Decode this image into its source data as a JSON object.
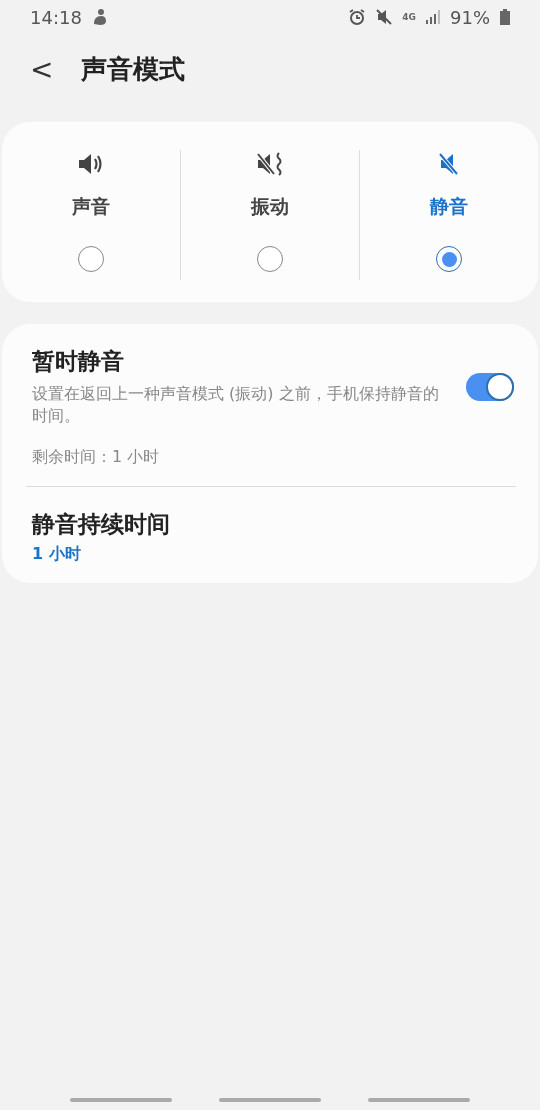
{
  "status_bar": {
    "time": "14:18",
    "network": "4G",
    "battery": "91%"
  },
  "header": {
    "back": "<",
    "title": "声音模式"
  },
  "modes": [
    {
      "kind": "sound",
      "label": "声音",
      "selected": false
    },
    {
      "kind": "vibrate",
      "label": "振动",
      "selected": false
    },
    {
      "kind": "mute",
      "label": "静音",
      "selected": true
    }
  ],
  "temporary_mute": {
    "title": "暂时静音",
    "description": "设置在返回上一种声音模式 (振动) 之前，手机保持静音的时间。",
    "on": true,
    "remaining": "剩余时间：1 小时"
  },
  "mute_duration": {
    "title": "静音持续时间",
    "value": "1 小时"
  }
}
